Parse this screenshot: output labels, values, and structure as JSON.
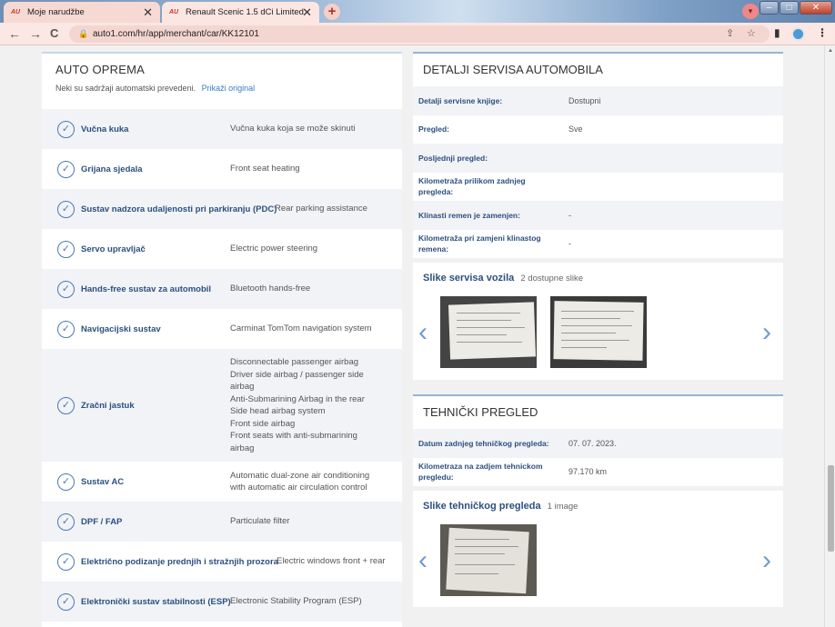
{
  "browser": {
    "tabs": [
      {
        "title": "Moje narudžbe",
        "active": false
      },
      {
        "title": "Renault Scenic 1.5 dCi Limited",
        "active": true
      }
    ],
    "new_tab": "+",
    "url": "auto1.com/hr/app/merchant/car/KK12101"
  },
  "equipment": {
    "title": "AUTO OPREMA",
    "note": "Neki su sadržaji automatski prevedeni.",
    "show_original": "Prikaži original",
    "items": [
      {
        "label": "Vučna kuka",
        "value": "Vučna kuka koja se može skinuti"
      },
      {
        "label": "Grijana sjedala",
        "value": "Front seat heating"
      },
      {
        "label": "Sustav nadzora udaljenosti pri parkiranju (PDC)",
        "value": "Rear parking assistance"
      },
      {
        "label": "Servo upravljač",
        "value": "Electric power steering"
      },
      {
        "label": "Hands-free sustav za automobil",
        "value": "Bluetooth hands-free"
      },
      {
        "label": "Navigacijski sustav",
        "value": "Carminat TomTom navigation system"
      },
      {
        "label": "Zračni jastuk",
        "value": "Disconnectable passenger airbag\nDriver side airbag / passenger side airbag\nAnti-Submarining Airbag in the rear\nSide head airbag system\nFront side airbag\nFront seats with anti-submarining airbag"
      },
      {
        "label": "Sustav AC",
        "value": "Automatic dual-zone air conditioning with automatic air circulation control"
      },
      {
        "label": "DPF / FAP",
        "value": "Particulate filter"
      },
      {
        "label": "Električno podizanje prednjih i stražnjih prozora",
        "value": "Electric windows front + rear"
      },
      {
        "label": "Elektronički sustav stabilnosti (ESP)",
        "value": "Electronic Stability Program (ESP)"
      }
    ]
  },
  "service": {
    "title": "DETALJI SERVISA AUTOMOBILA",
    "rows": [
      {
        "key": "Detalji servisne knjige:",
        "value": "Dostupni"
      },
      {
        "key": "Pregled:",
        "value": "Sve"
      },
      {
        "key": "Posljednji pregled:",
        "value": ""
      },
      {
        "key": "Kilometraža prilikom zadnjeg pregleda:",
        "value": ""
      },
      {
        "key": "Klinasti remen je zamenjen:",
        "value": "-"
      },
      {
        "key": "Kilometraža pri zamjeni klinastog remena:",
        "value": "-"
      }
    ],
    "images_title": "Slike servisa vozila",
    "images_count": "2 dostupne slike"
  },
  "inspection": {
    "title": "TEHNIČKI PREGLED",
    "rows": [
      {
        "key": "Datum zadnjeg tehničkog pregleda:",
        "value": "07. 07. 2023."
      },
      {
        "key": "Kilometraza na zadjem tehnickom pregledu:",
        "value": "97.170 km"
      }
    ],
    "images_title": "Slike tehničkog pregleda",
    "images_count": "1 image"
  }
}
